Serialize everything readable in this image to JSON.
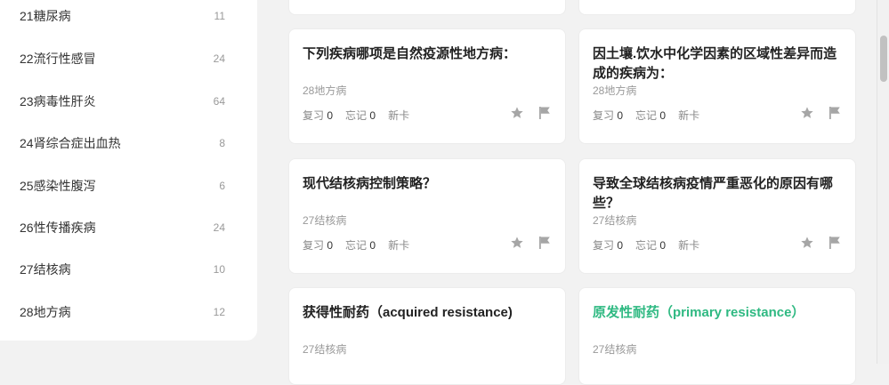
{
  "sidebar": {
    "items": [
      {
        "label": "21糖尿病",
        "count": "11"
      },
      {
        "label": "22流行性感冒",
        "count": "24"
      },
      {
        "label": "23病毒性肝炎",
        "count": "64"
      },
      {
        "label": "24肾综合症出血热",
        "count": "8"
      },
      {
        "label": "25感染性腹泻",
        "count": "6"
      },
      {
        "label": "26性传播疾病",
        "count": "24"
      },
      {
        "label": "27结核病",
        "count": "10"
      },
      {
        "label": "28地方病",
        "count": "12"
      }
    ]
  },
  "stat_labels": {
    "review": "复习",
    "forget": "忘记",
    "new": "新卡"
  },
  "cards": [
    {
      "question": "下列疾病哪项是自然疫源性地方病：",
      "category": "28地方病",
      "review": "0",
      "forget": "0"
    },
    {
      "question": "因土壤.饮水中化学因素的区域性差异而造成的疾病为：",
      "category": "28地方病",
      "review": "0",
      "forget": "0"
    },
    {
      "question": "现代结核病控制策略？",
      "category": "27结核病",
      "review": "0",
      "forget": "0"
    },
    {
      "question": "导致全球结核病疫情严重恶化的原因有哪些？",
      "category": "27结核病",
      "review": "0",
      "forget": "0"
    },
    {
      "question": "获得性耐药（acquired resistance)",
      "category": "27结核病"
    },
    {
      "question": "原发性耐药（primary resistance）",
      "category": "27结核病",
      "highlight": "#2fb982"
    }
  ],
  "icons": {
    "star": "star-icon",
    "flag": "flag-icon"
  }
}
